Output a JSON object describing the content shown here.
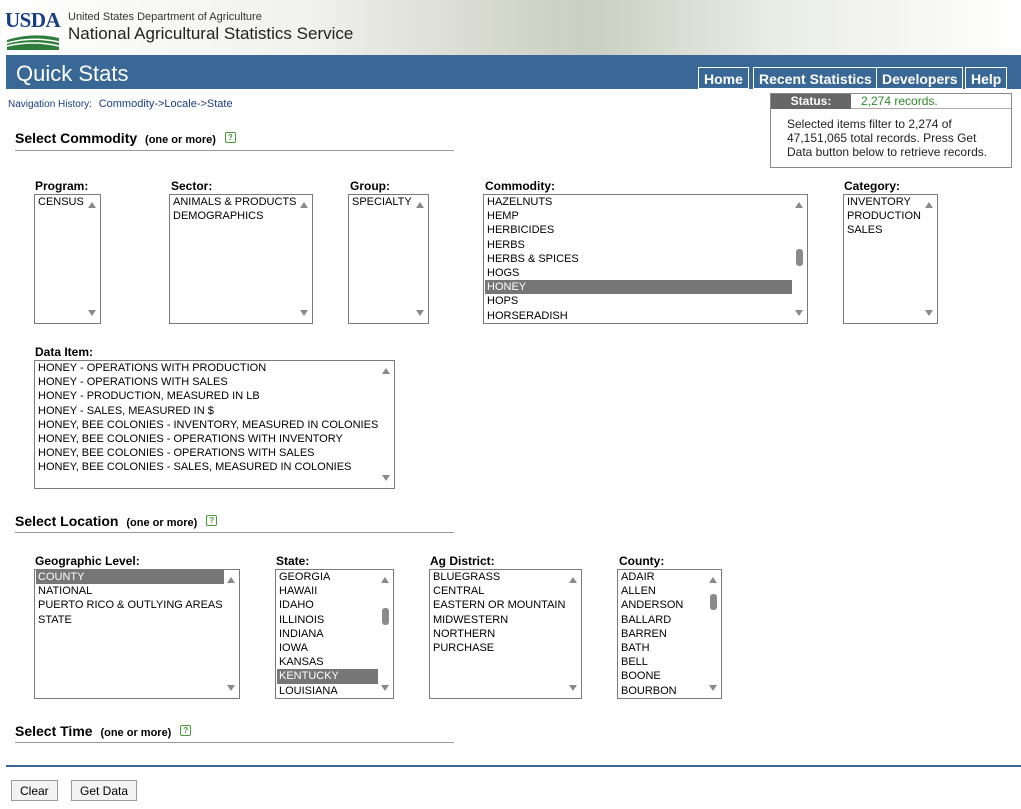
{
  "header": {
    "logo_text": "USDA",
    "department": "United States Department of Agriculture",
    "agency": "National Agricultural Statistics Service"
  },
  "bar": {
    "title": "Quick Stats",
    "nav": [
      "Home",
      "Recent Statistics",
      "Developers",
      "Help"
    ]
  },
  "nav_history": {
    "label": "Navigation History:",
    "crumbs": "Commodity->Locale->State"
  },
  "status": {
    "label": "Status:",
    "value": "2,274 records.",
    "message": "Selected items filter to 2,274 of 47,151,065 total records. Press Get Data button below to retrieve records."
  },
  "commodity_section": {
    "title": "Select Commodity",
    "subtitle": "(one or more)",
    "program": {
      "label": "Program:",
      "options": [
        "CENSUS"
      ]
    },
    "sector": {
      "label": "Sector:",
      "options": [
        "ANIMALS & PRODUCTS",
        "DEMOGRAPHICS"
      ]
    },
    "group": {
      "label": "Group:",
      "options": [
        "SPECIALTY"
      ]
    },
    "commodity": {
      "label": "Commodity:",
      "options": [
        "HAZELNUTS",
        "HEMP",
        "HERBICIDES",
        "HERBS",
        "HERBS & SPICES",
        "HOGS",
        "HONEY",
        "HOPS",
        "HORSERADISH"
      ],
      "selected": "HONEY"
    },
    "category": {
      "label": "Category:",
      "options": [
        "INVENTORY",
        "PRODUCTION",
        "SALES"
      ]
    },
    "data_item": {
      "label": "Data Item:",
      "options": [
        "HONEY - OPERATIONS WITH PRODUCTION",
        "HONEY - OPERATIONS WITH SALES",
        "HONEY - PRODUCTION, MEASURED IN LB",
        "HONEY - SALES, MEASURED IN $",
        "HONEY, BEE COLONIES - INVENTORY, MEASURED IN COLONIES",
        "HONEY, BEE COLONIES - OPERATIONS WITH INVENTORY",
        "HONEY, BEE COLONIES - OPERATIONS WITH SALES",
        "HONEY, BEE COLONIES - SALES, MEASURED IN COLONIES"
      ]
    }
  },
  "location_section": {
    "title": "Select Location",
    "subtitle": "(one or more)",
    "geo_level": {
      "label": "Geographic Level:",
      "options": [
        "COUNTY",
        "NATIONAL",
        "PUERTO RICO & OUTLYING AREAS",
        "STATE"
      ],
      "selected": "COUNTY"
    },
    "state": {
      "label": "State:",
      "options": [
        "GEORGIA",
        "HAWAII",
        "IDAHO",
        "ILLINOIS",
        "INDIANA",
        "IOWA",
        "KANSAS",
        "KENTUCKY",
        "LOUISIANA"
      ],
      "selected": "KENTUCKY"
    },
    "ag_district": {
      "label": "Ag District:",
      "options": [
        "BLUEGRASS",
        "CENTRAL",
        "EASTERN OR MOUNTAIN",
        "MIDWESTERN",
        "NORTHERN",
        "PURCHASE"
      ]
    },
    "county": {
      "label": "County:",
      "options": [
        "ADAIR",
        "ALLEN",
        "ANDERSON",
        "BALLARD",
        "BARREN",
        "BATH",
        "BELL",
        "BOONE",
        "BOURBON"
      ]
    }
  },
  "time_section": {
    "title": "Select Time",
    "subtitle": "(one or more)"
  },
  "buttons": {
    "clear": "Clear",
    "get_data": "Get Data"
  },
  "colors": {
    "bar": "#3a6896",
    "selected_option": "#767676",
    "status_value": "#2a8a2a"
  }
}
